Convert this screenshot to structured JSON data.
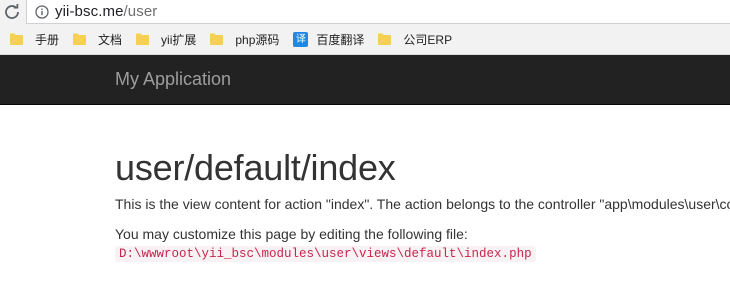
{
  "browser": {
    "address_bar": {
      "host": "yii-bsc.me",
      "path": "/user",
      "reload_icon": "reload-icon",
      "info_icon": "info-icon"
    },
    "bookmarks": [
      {
        "label": "手册",
        "icon": "folder-icon"
      },
      {
        "label": "文档",
        "icon": "folder-icon"
      },
      {
        "label": "yii扩展",
        "icon": "folder-icon"
      },
      {
        "label": "php源码",
        "icon": "folder-icon"
      },
      {
        "label": "百度翻译",
        "icon": "translate-icon",
        "icon_text": "译"
      },
      {
        "label": "公司ERP",
        "icon": "folder-icon"
      }
    ]
  },
  "navbar": {
    "brand": "My Application"
  },
  "page": {
    "title": "user/default/index",
    "paragraph_1": "This is the view content for action \"index\". The action belongs to the controller \"app\\modules\\user\\controllers\\DefaultController\"",
    "paragraph_2": "You may customize this page by editing the following file:",
    "file_path": "D:\\wwwroot\\yii_bsc\\modules\\user\\views\\default\\index.php"
  },
  "colors": {
    "navbar_bg": "#222222",
    "brand_text": "#9d9d9d",
    "code_text": "#c7254e",
    "code_bg": "#f9f2f4",
    "folder": "#f6cf57"
  }
}
